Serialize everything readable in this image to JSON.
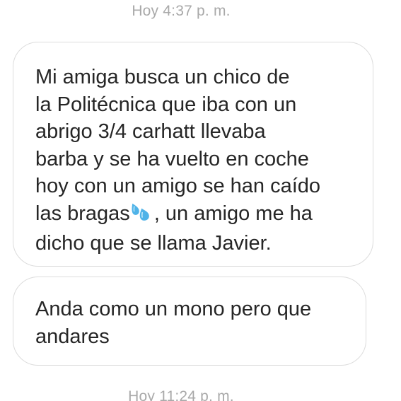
{
  "conversation": {
    "timestamp_top": "Hoy 4:37 p. m.",
    "timestamp_bottom": "Hoy 11:24 p. m.",
    "messages": [
      {
        "lines": [
          "Mi amiga busca un chico de",
          "la Politécnica que iba con un",
          "abrigo 3/4 carhatt llevaba",
          "barba y se ha vuelto en coche",
          "hoy con un amigo se han caído",
          "las bragas",
          ", un amigo me ha",
          "dicho que se llama Javier."
        ],
        "emoji": "sweat-droplets-icon"
      },
      {
        "lines": [
          "Anda como un mono pero que",
          "andares"
        ]
      }
    ]
  },
  "colors": {
    "background": "#ffffff",
    "bubble_border": "#dcdcdc",
    "message_text": "#262626",
    "timestamp_text": "#a9a9a9",
    "emoji_blue": "#4fb3e8"
  }
}
